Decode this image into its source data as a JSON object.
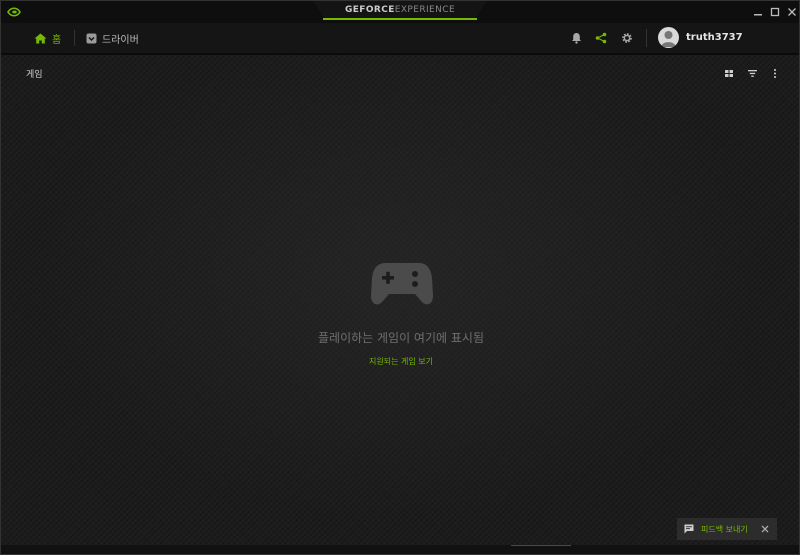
{
  "titlebar": {
    "brand_bold": "GEFORCE",
    "brand_light": "EXPERIENCE",
    "icons": [
      "nvidia-logo-icon",
      "minimize-icon",
      "maximize-icon",
      "close-icon"
    ]
  },
  "nav": {
    "home_label": "홈",
    "drivers_label": "드라이버",
    "username": "truth3737",
    "icons": [
      "home-icon",
      "drivers-icon",
      "notification-bell-icon",
      "share-icon",
      "settings-gear-icon",
      "avatar"
    ]
  },
  "content": {
    "section_title": "게임",
    "empty_message": "플레이하는 게임이 여기에 표시됨",
    "supported_games_link": "지원되는 게임 보기",
    "tool_icons": [
      "grid-view-icon",
      "filter-icon",
      "more-options-icon"
    ]
  },
  "feedback": {
    "label": "피드백 보내기"
  },
  "colors": {
    "accent": "#76b900",
    "background": "#1b1b1b",
    "text_muted": "#6f6f6f"
  }
}
